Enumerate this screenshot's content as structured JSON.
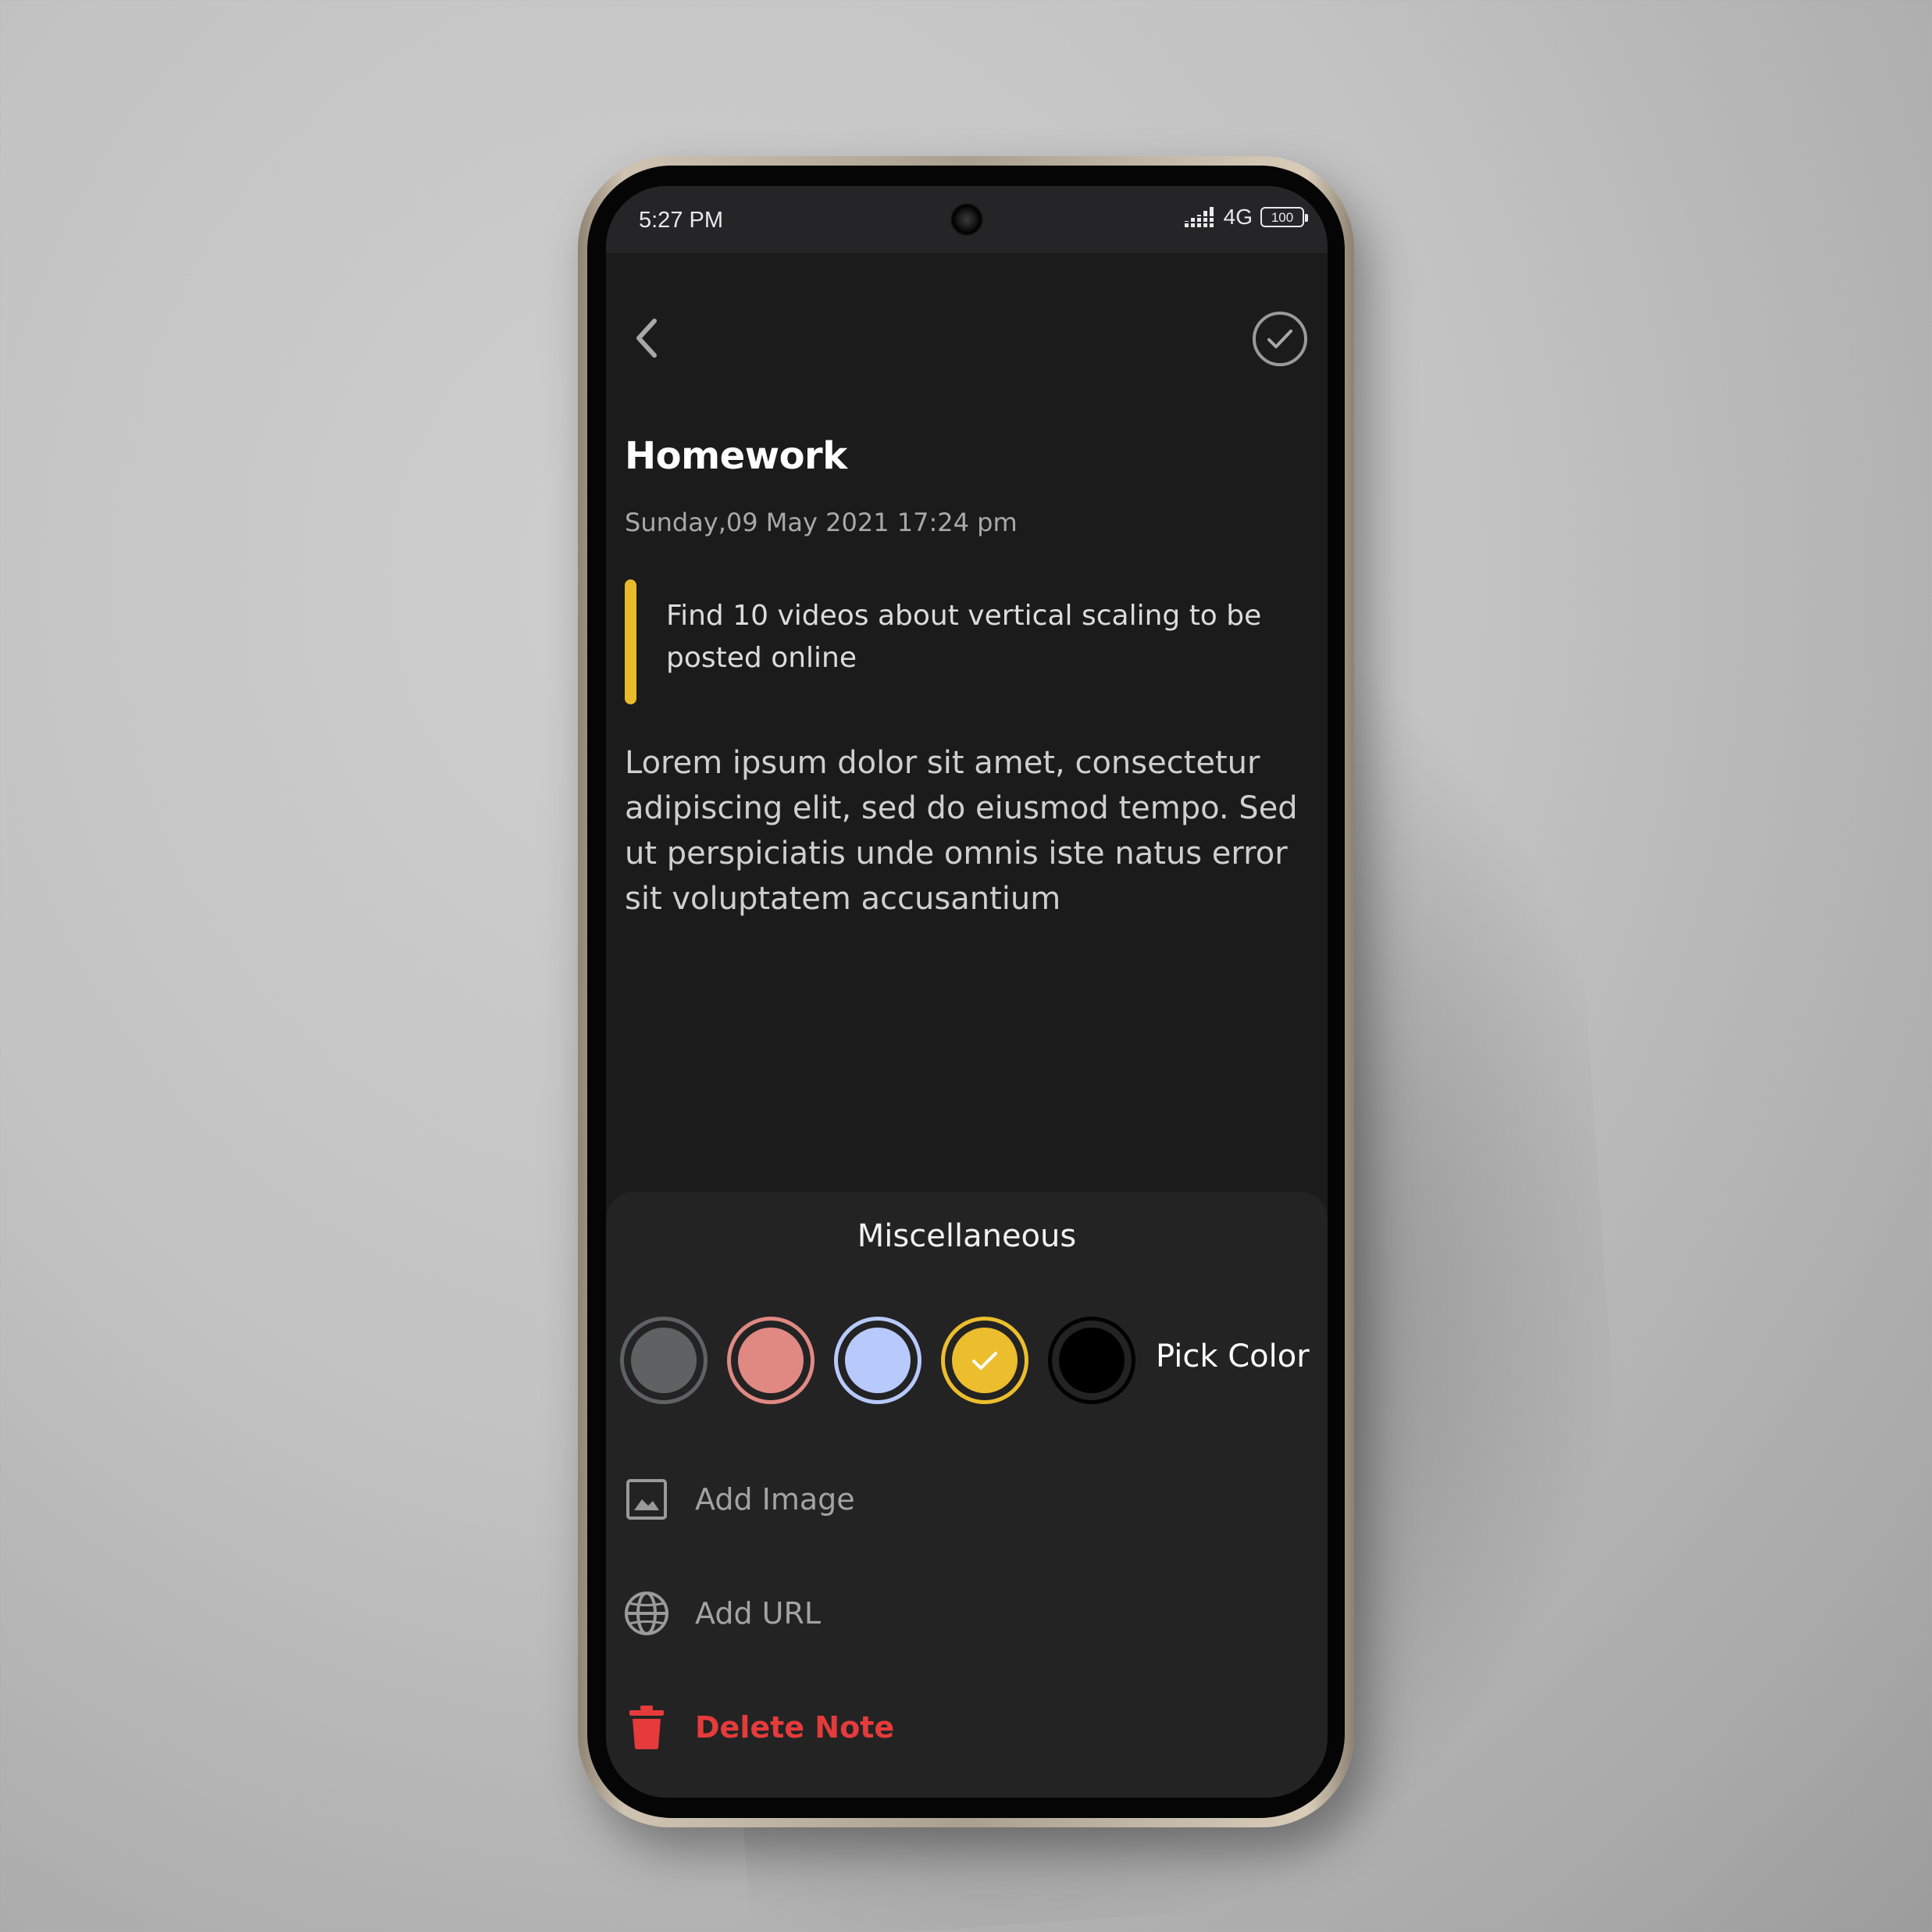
{
  "status_bar": {
    "time": "5:27 PM",
    "network": "4G",
    "battery": "100"
  },
  "note": {
    "title": "Homework",
    "date": "Sunday,09 May 2021 17:24 pm",
    "subtitle": "Find 10 videos about vertical scaling to be posted online",
    "body": "Lorem ipsum dolor sit amet, consectetur adipiscing elit, sed do eiusmod tempo. Sed ut perspiciatis unde omnis iste natus error sit voluptatem accusantium",
    "accent_color": "#e9bb2c"
  },
  "miscellaneous": {
    "title": "Miscellaneous",
    "colors": [
      {
        "name": "gray",
        "fill": "#5f6263",
        "ring": "#5f6263",
        "selected": false
      },
      {
        "name": "red",
        "fill": "#e08983",
        "ring": "#e08983",
        "selected": false
      },
      {
        "name": "blue",
        "fill": "#b8c9fb",
        "ring": "#b8c9fb",
        "selected": false
      },
      {
        "name": "yellow",
        "fill": "#ecbd2d",
        "ring": "#ecbd2d",
        "selected": true
      },
      {
        "name": "black",
        "fill": "#000000",
        "ring": "#000000",
        "selected": false
      }
    ],
    "pick_color_label": "Pick Color",
    "add_image_label": "Add Image",
    "add_url_label": "Add URL",
    "delete_note_label": "Delete Note",
    "delete_color": "#e53b3b"
  }
}
